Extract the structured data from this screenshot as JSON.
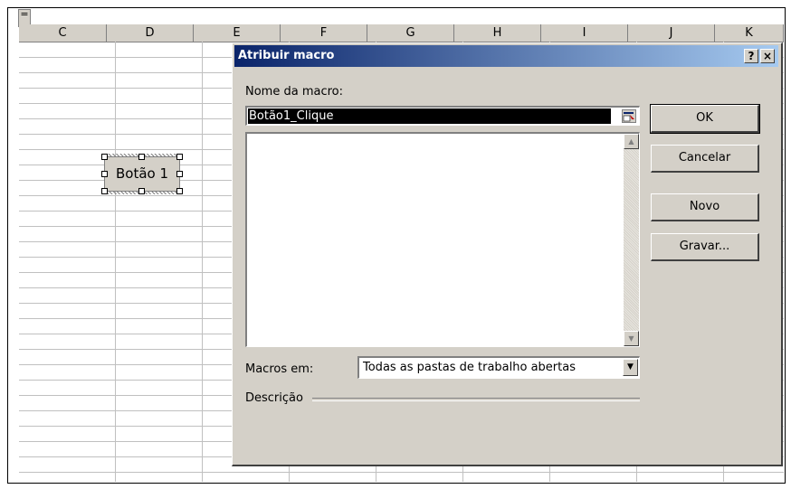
{
  "spreadsheet": {
    "columns": [
      "C",
      "D",
      "E",
      "F",
      "G",
      "H",
      "I",
      "J",
      "K"
    ],
    "form_button_label": "Botão 1"
  },
  "dialog": {
    "title": "Atribuir macro",
    "help_label": "?",
    "close_label": "×",
    "macro_name_label": "Nome da macro:",
    "macro_name_value": "Botão1_Clique",
    "macros": [],
    "macros_in_label": "Macros em:",
    "macros_in_value": "Todas as pastas de trabalho abertas",
    "description_label": "Descrição",
    "buttons": {
      "ok": "OK",
      "cancel": "Cancelar",
      "new": "Novo",
      "record": "Gravar..."
    }
  },
  "colors": {
    "title_gradient_start": "#0a246a",
    "title_gradient_end": "#a6caf0",
    "dialog_face": "#d4d0c8",
    "selection": "#000000"
  }
}
